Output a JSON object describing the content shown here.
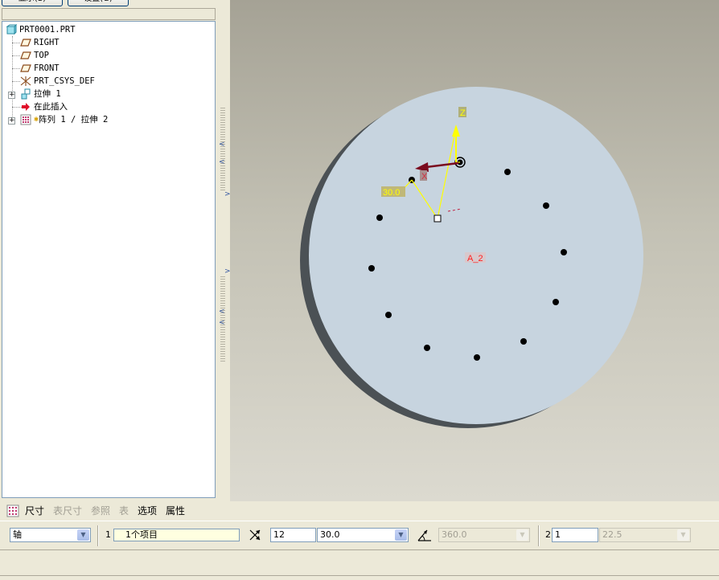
{
  "top_buttons": {
    "show": "显示(S)",
    "settings": "设置(G)"
  },
  "model_tree": {
    "items": [
      {
        "label": "PRT0001.PRT",
        "icon": "part-icon"
      },
      {
        "label": "RIGHT",
        "icon": "datum-plane-icon"
      },
      {
        "label": "TOP",
        "icon": "datum-plane-icon"
      },
      {
        "label": "FRONT",
        "icon": "datum-plane-icon"
      },
      {
        "label": "PRT_CSYS_DEF",
        "icon": "csys-icon"
      },
      {
        "label": "拉伸 1",
        "icon": "extrude-icon"
      },
      {
        "label": "在此插入",
        "icon": "insert-here-arrow-icon"
      },
      {
        "label": "阵列 1 / 拉伸 2",
        "icon": "pattern-icon"
      }
    ]
  },
  "viewport": {
    "annotations": {
      "z_label": "Z",
      "x_label": "X",
      "angle_label": "30.0",
      "axis_label": "A_2"
    },
    "colors": {
      "face": "#c7d4df",
      "side": "#4b5155",
      "background_top": "#a5a295",
      "background_bottom": "#dcdad0",
      "axis_yellow": "#ffff00",
      "axis_red": "#7a0a1e",
      "axis_label_red": "#ff2020"
    }
  },
  "dashboard": {
    "tabs": [
      {
        "label": "尺寸",
        "active": true
      },
      {
        "label": "表尺寸",
        "active": false
      },
      {
        "label": "参照",
        "active": false
      },
      {
        "label": "表",
        "active": false
      },
      {
        "label": "选项",
        "active": true
      },
      {
        "label": "属性",
        "active": true
      }
    ],
    "pattern_type": "轴",
    "first_direction_num": "1",
    "first_direction_collector": "1个项目",
    "member_count": "12",
    "increment": "30.0",
    "angular_extent": "360.0",
    "second_direction_num": "2",
    "second_direction_count": "1",
    "second_increment": "22.5"
  }
}
